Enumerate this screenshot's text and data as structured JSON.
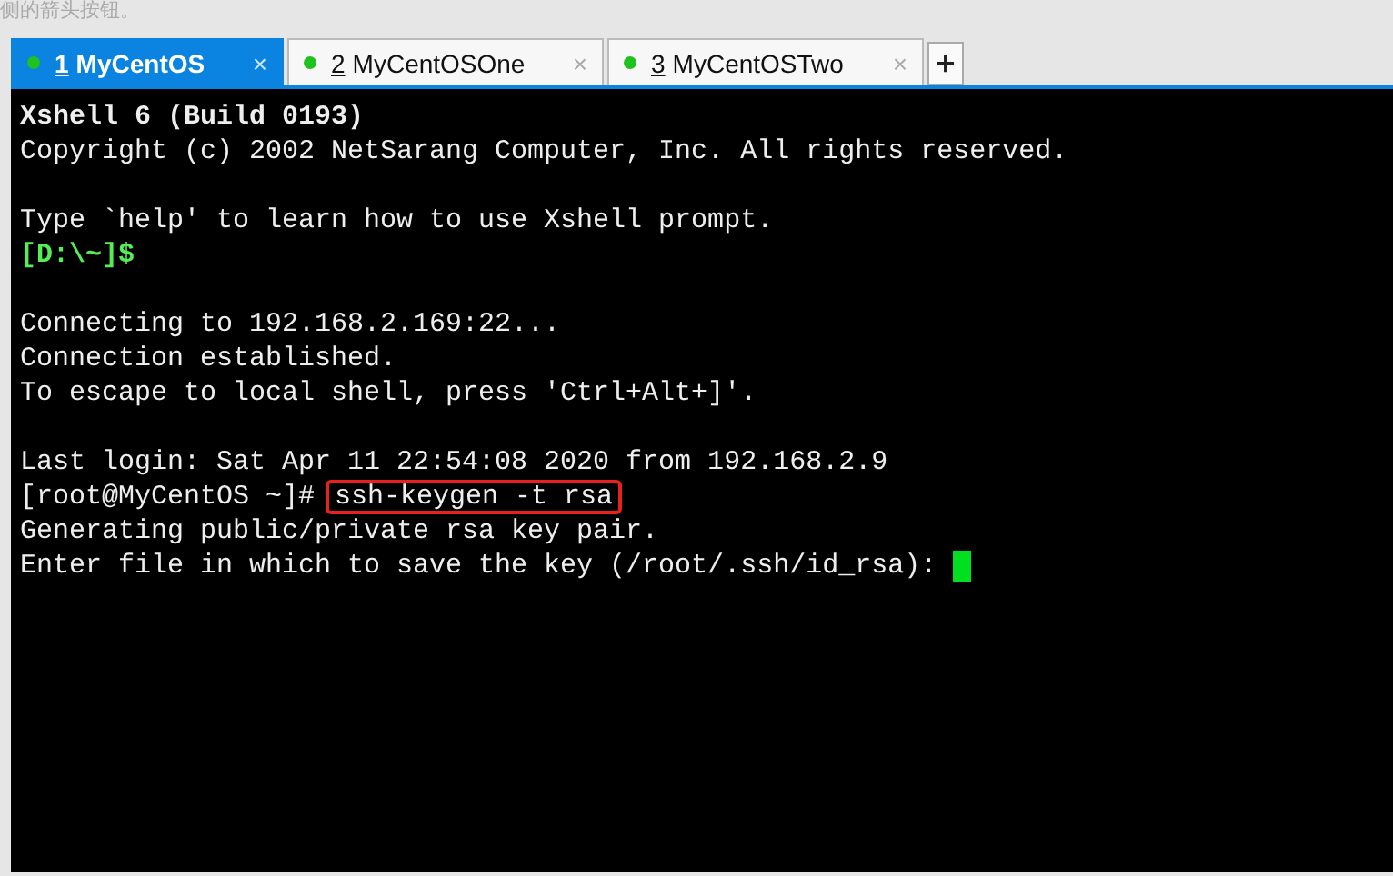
{
  "caption": "侧的箭头按钮。",
  "tabs": [
    {
      "number": "1",
      "label": "MyCentOS",
      "selected": true,
      "connected": true,
      "close": "×"
    },
    {
      "number": "2",
      "label": "MyCentOSOne",
      "selected": false,
      "connected": true,
      "close": "×"
    },
    {
      "number": "3",
      "label": "MyCentOSTwo",
      "selected": false,
      "connected": true,
      "close": "×"
    }
  ],
  "new_tab": "+",
  "terminal": {
    "lines": [
      {
        "kind": "bold",
        "text": "Xshell 6 (Build 0193)"
      },
      {
        "kind": "text",
        "text": "Copyright (c) 2002 NetSarang Computer, Inc. All rights reserved."
      },
      {
        "kind": "blank"
      },
      {
        "kind": "text",
        "text": "Type `help' to learn how to use Xshell prompt."
      },
      {
        "kind": "prompt",
        "text": "[D:\\~]$"
      },
      {
        "kind": "blank"
      },
      {
        "kind": "text",
        "text": "Connecting to 192.168.2.169:22..."
      },
      {
        "kind": "text",
        "text": "Connection established."
      },
      {
        "kind": "text",
        "text": "To escape to local shell, press 'Ctrl+Alt+]'."
      },
      {
        "kind": "blank"
      },
      {
        "kind": "text",
        "text": "Last login: Sat Apr 11 22:54:08 2020 from 192.168.2.9"
      },
      {
        "kind": "command",
        "prompt": "[root@MyCentOS ~]#",
        "command": "ssh-keygen -t rsa",
        "highlighted": true
      },
      {
        "kind": "text",
        "text": "Generating public/private rsa key pair."
      },
      {
        "kind": "input",
        "text": "Enter file in which to save the key (/root/.ssh/id_rsa):",
        "cursor": true
      }
    ]
  }
}
